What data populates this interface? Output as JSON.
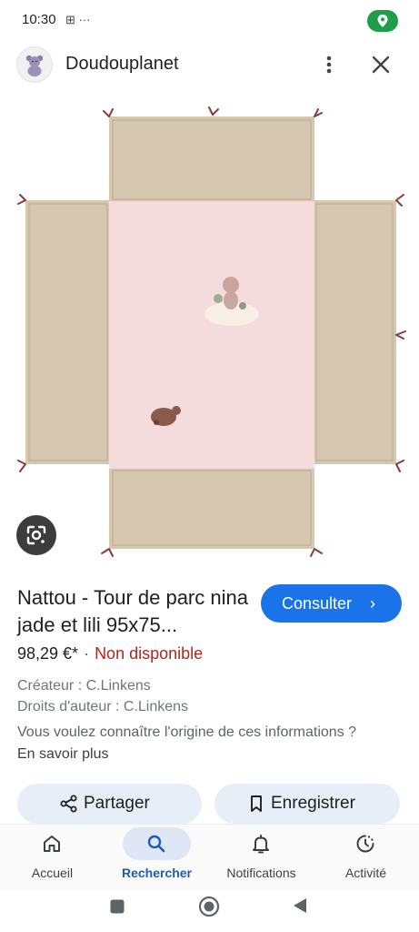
{
  "status_bar": {
    "time": "10:30",
    "icons_text": "⊞ ···"
  },
  "header": {
    "site_name": "Doudouplanet"
  },
  "product": {
    "title": "Nattou - Tour de parc nina jade et lili 95x75...",
    "cta_label": "Consulter",
    "cta_chevron": "›",
    "price": "98,29 €*",
    "separator": "·",
    "availability": "Non disponible",
    "creator": "Créateur : C.Linkens",
    "copyright": "Droits d'auteur : C.Linkens",
    "origin_question": "Vous voulez connaître l'origine de ces informations ?",
    "learn_more": "En savoir plus"
  },
  "actions": {
    "share_label": "Partager",
    "save_label": "Enregistrer"
  },
  "bottom_nav": [
    {
      "label": "Accueil",
      "icon": "home-icon"
    },
    {
      "label": "Rechercher",
      "icon": "search-icon",
      "active": true
    },
    {
      "label": "Notifications",
      "icon": "bell-icon"
    },
    {
      "label": "Activité",
      "icon": "activity-icon"
    }
  ],
  "colors": {
    "accent": "#1a73e8",
    "unavailable": "#b3261e",
    "location_pill": "#1e9e4a"
  }
}
